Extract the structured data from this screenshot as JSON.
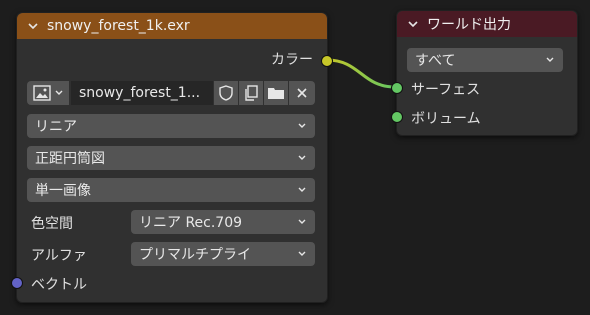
{
  "colors": {
    "background": "#1d1d1d",
    "node_body": "#303030",
    "image_header": "#8a5018",
    "output_header": "#4a1a24",
    "field": "#545454",
    "socket_color": "#c7c729",
    "socket_shader": "#63c763",
    "socket_vector": "#6363c7"
  },
  "image_node": {
    "title": "snowy_forest_1k.exr",
    "outputs": {
      "color_label": "カラー"
    },
    "image_name": "snowy_forest_1...",
    "interpolation": "リニア",
    "projection": "正距円筒図",
    "source": "単一画像",
    "colorspace_label": "色空間",
    "colorspace_value": "リニア Rec.709",
    "alpha_label": "アルファ",
    "alpha_value": "プリマルチプライ",
    "inputs": {
      "vector_label": "ベクトル"
    }
  },
  "output_node": {
    "title": "ワールド出力",
    "target": "すべて",
    "inputs": {
      "surface_label": "サーフェス",
      "volume_label": "ボリューム"
    }
  },
  "icons": [
    "chevron-down-icon",
    "image-icon",
    "shield-icon",
    "duplicate-icon",
    "folder-icon",
    "close-icon"
  ]
}
